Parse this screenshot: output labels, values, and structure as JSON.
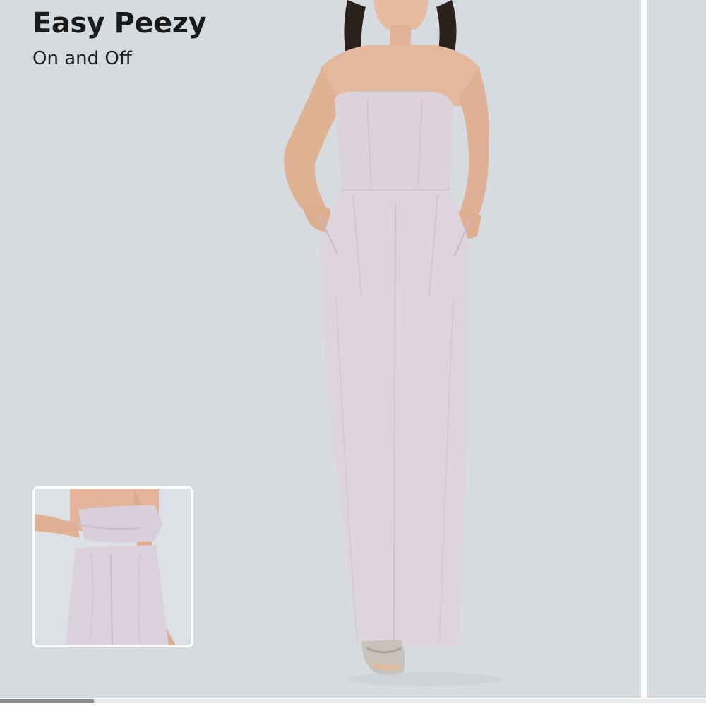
{
  "carousel": {
    "current_slide": {
      "headline": "Easy Peezy",
      "subhead": "On and Off"
    },
    "progress_fraction": 0.133,
    "colors": {
      "background": "#d6dbe0",
      "garment": "#dcd3dc",
      "skin": "#e3b79a",
      "text": "#1a1a1a",
      "progress": "#8a8a8a"
    }
  },
  "icons": {
    "model_photo": "model-photo",
    "detail_photo": "detail-inset-photo"
  }
}
